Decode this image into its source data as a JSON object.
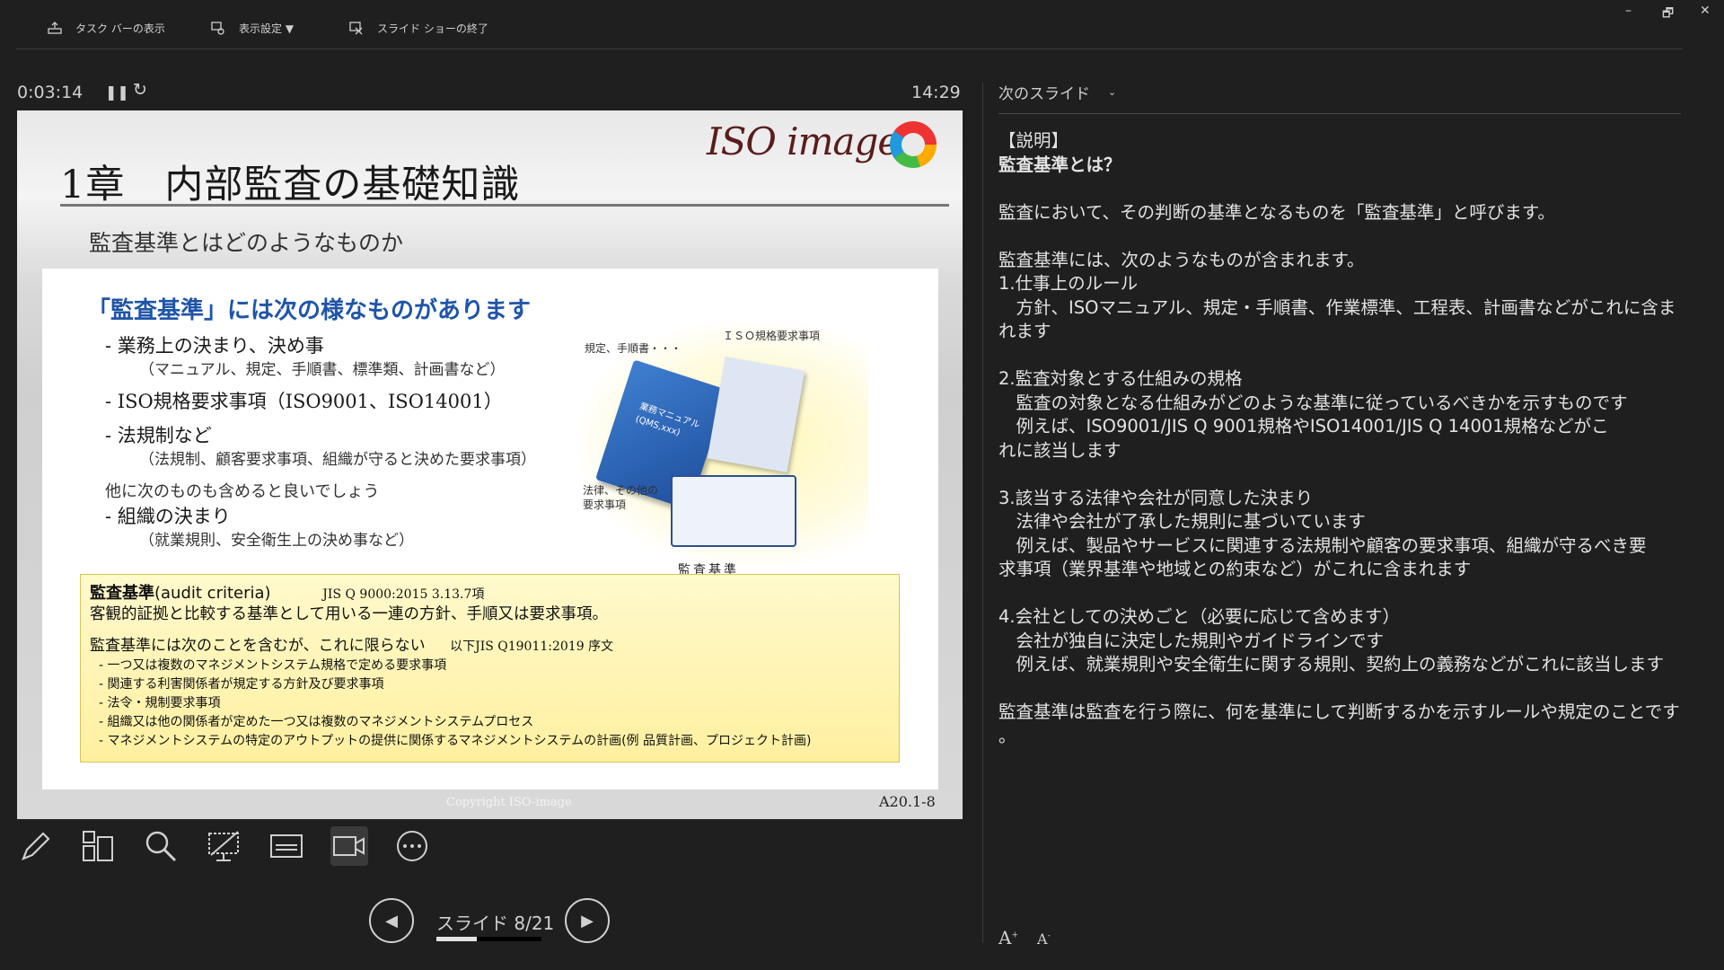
{
  "toolbar": {
    "taskbar_label": "タスク バーの表示",
    "display_settings_label": "表示設定 ▼",
    "end_show_label": "スライド ショーの終了"
  },
  "window": {
    "minimize": "–",
    "restore": "🗗",
    "close": "✕"
  },
  "timer": {
    "elapsed": "0:03:14",
    "pause": "❚❚",
    "restart": "↻",
    "clock": "14:29"
  },
  "slide": {
    "title": "1章　内部監査の基礎知識",
    "subtitle": "監査基準とはどのようなものか",
    "logo_text": "ISO image",
    "heading": "「監査基準」には次の様なものがあります",
    "bullets": [
      {
        "main": "- 業務上の決まり、決め事",
        "sub": "（マニュアル、規定、手順書、標準類、計画書など）"
      },
      {
        "main": "- ISO規格要求事項（ISO9001、ISO14001）",
        "sub": ""
      },
      {
        "main": "- 法規制など",
        "sub": "（法規制、顧客要求事項、組織が守ると決めた要求事項）"
      }
    ],
    "note": "他に次のものも含めると良いでしょう",
    "bullet4": {
      "main": "- 組織の決まり",
      "sub": "（就業規則、安全衛生上の決め事など）"
    },
    "illustration": {
      "label_rules": "規定、手順書・・・",
      "label_iso": "ＩＳＯ規格要求事項",
      "label_law": "法律、その他の\n要求事項",
      "book_text": "業務マニュアル\n(QMS,xxx)",
      "caption": "監査基準"
    },
    "definition": {
      "term": "監査基準",
      "term_en": "(audit criteria)",
      "ref1": "JIS Q 9000:2015 3.13.7項",
      "line1": "客観的証拠と比較する基準として用いる一連の方針、手順又は要求事項。",
      "line2": "監査基準には次のことを含むが、これに限らない",
      "ref2": "以下JIS Q19011:2019 序文",
      "items": [
        "- 一つ又は複数のマネジメントシステム規格で定める要求事項",
        "- 関連する利害関係者が規定する方針及び要求事項",
        "- 法令・規制要求事項",
        "- 組織又は他の関係者が定めた一つ又は複数のマネジメントシステムプロセス",
        "- マネジメントシステムの特定のアウトプットの提供に関係するマネジメントシステムの計画(例 品質計画、プロジェクト計画)"
      ]
    },
    "copyright": "Copyright  ISO-image",
    "slide_id": "A20.1-8"
  },
  "navigation": {
    "counter": "スライド 8/21",
    "progress": 0.381
  },
  "notes_pane": {
    "header": "次のスライド",
    "lines": [
      "【説明】",
      "監査基準とは？",
      "",
      "監査において、その判断の基準となるものを「監査基準」と呼びます。",
      "",
      "監査基準には、次のようなものが含まれます。",
      "1.仕事上のルール",
      "　方針、ISOマニュアル、規定・手順書、作業標準、工程表、計画書などがこれに含ま",
      "れます",
      "",
      "2.監査対象とする仕組みの規格",
      "　監査の対象となる仕組みがどのような基準に従っているべきかを示すものです",
      "　例えば、ISO9001/JIS Q 9001規格やISO14001/JIS Q 14001規格などがこ",
      "れに該当します",
      "",
      "3.該当する法律や会社が同意した決まり",
      "　法律や会社が了承した規則に基づいています",
      "　例えば、製品やサービスに関連する法規制や顧客の要求事項、組織が守るべき要",
      "求事項（業界基準や地域との約束など）がこれに含まれます",
      "",
      "4.会社としての決めごと（必要に応じて含めます）",
      "　会社が独自に決定した規則やガイドラインです",
      "　例えば、就業規則や安全衛生に関する規則、契約上の義務などがこれに該当します",
      "",
      "監査基準は監査を行う際に、何を基準にして判断するかを示すルールや規定のことです",
      "。"
    ],
    "font_up": "A",
    "font_down": "A"
  }
}
